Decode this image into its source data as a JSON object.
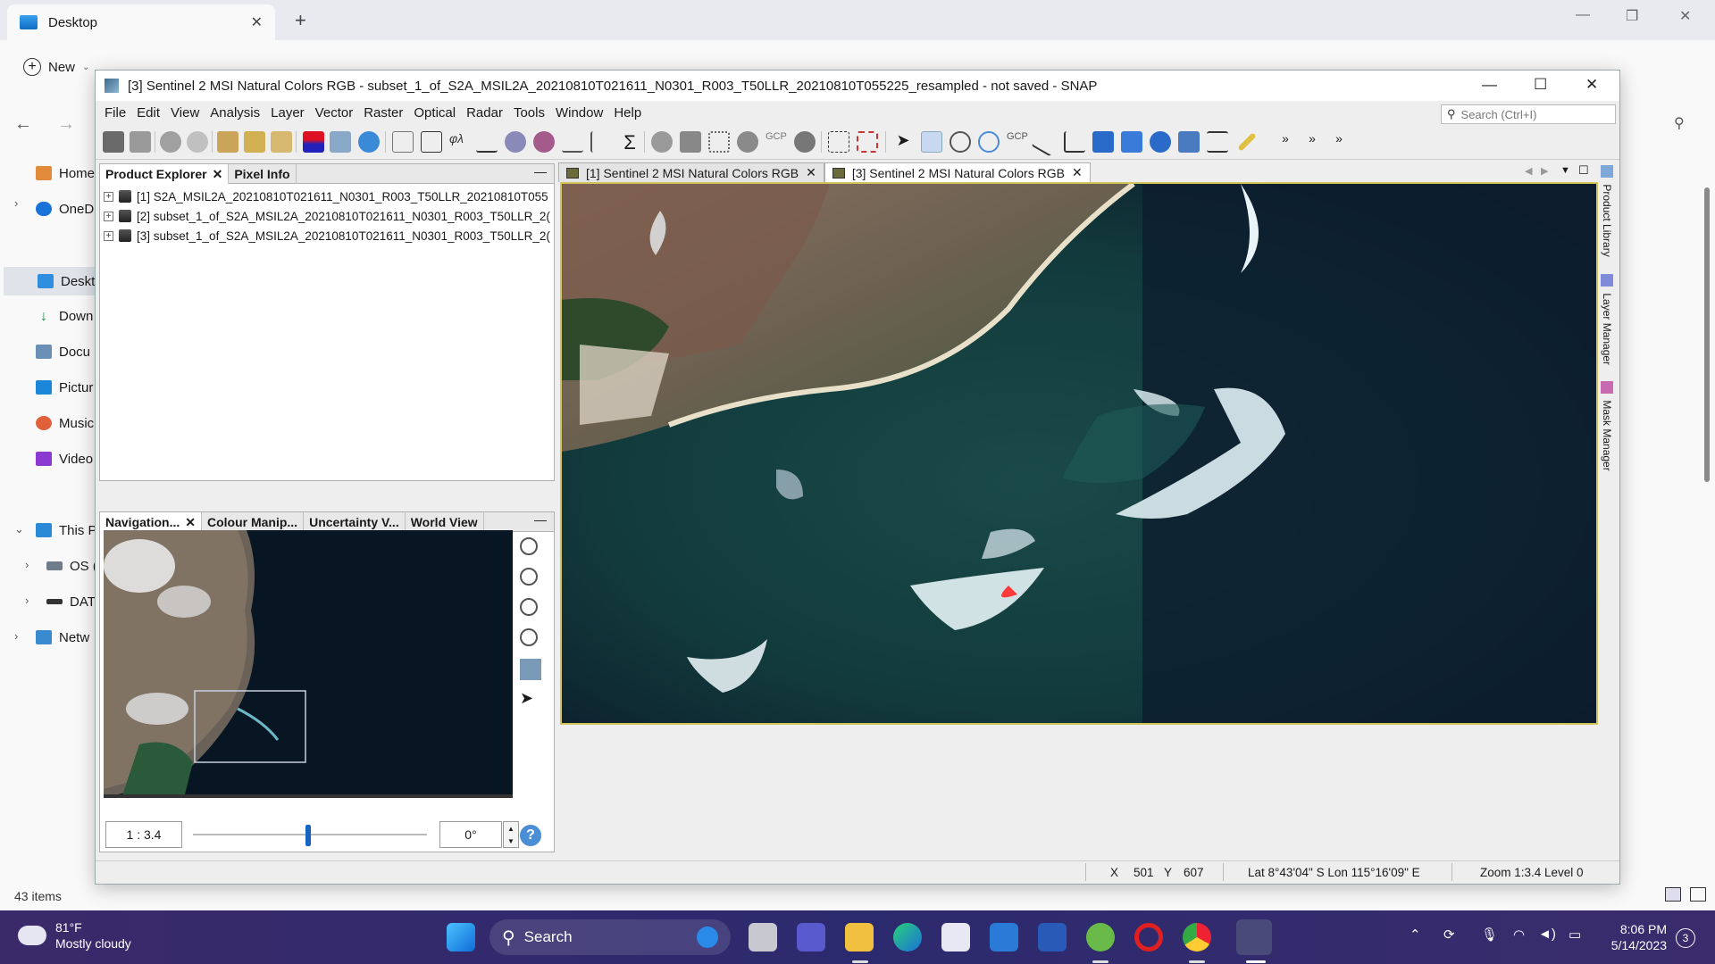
{
  "explorer": {
    "tab_title": "Desktop",
    "new_label": "New",
    "sidebar": [
      {
        "label": "Home",
        "icon": "home-icon"
      },
      {
        "label": "OneD",
        "icon": "onedrive-icon"
      },
      {
        "label": "Deskt",
        "icon": "desktop-icon"
      },
      {
        "label": "Down",
        "icon": "download-icon"
      },
      {
        "label": "Docu",
        "icon": "documents-icon"
      },
      {
        "label": "Pictur",
        "icon": "pictures-icon"
      },
      {
        "label": "Music",
        "icon": "music-icon"
      },
      {
        "label": "Video",
        "icon": "videos-icon"
      },
      {
        "label": "This P",
        "icon": "this-pc-icon"
      },
      {
        "label": "OS (",
        "icon": "drive-icon"
      },
      {
        "label": "DAT",
        "icon": "drive-icon"
      },
      {
        "label": "Netw",
        "icon": "network-icon"
      }
    ],
    "status": "43 items"
  },
  "snap": {
    "title": "[3] Sentinel 2 MSI Natural Colors RGB - subset_1_of_S2A_MSIL2A_20210810T021611_N0301_R003_T50LLR_20210810T055225_resampled - not saved - SNAP",
    "menu": [
      "File",
      "Edit",
      "View",
      "Analysis",
      "Layer",
      "Vector",
      "Raster",
      "Optical",
      "Radar",
      "Tools",
      "Window",
      "Help"
    ],
    "search_placeholder": "Search (Ctrl+I)",
    "product_tabs": [
      "Product Explorer",
      "Pixel Info"
    ],
    "products": [
      "[1] S2A_MSIL2A_20210810T021611_N0301_R003_T50LLR_20210810T055",
      "[2] subset_1_of_S2A_MSIL2A_20210810T021611_N0301_R003_T50LLR_2(",
      "[3] subset_1_of_S2A_MSIL2A_20210810T021611_N0301_R003_T50LLR_2("
    ],
    "tool_tabs": [
      "Navigation...",
      "Colour Manip...",
      "Uncertainty V...",
      "World View"
    ],
    "nav_zoom": "1 : 3.4",
    "nav_angle": "0°",
    "view_tabs": [
      "[1] Sentinel 2 MSI Natural Colors RGB",
      "[3] Sentinel 2 MSI Natural Colors RGB"
    ],
    "right_panels": [
      "Product Library",
      "Layer Manager",
      "Mask Manager"
    ],
    "status": {
      "x_label": "X",
      "x_value": "501",
      "y_label": "Y",
      "y_value": "607",
      "latlon": "Lat 8°43'04\" S  Lon 115°16'09\" E",
      "zoom": "Zoom 1:3.4  Level 0"
    }
  },
  "taskbar": {
    "weather_temp": "81°F",
    "weather_desc": "Mostly cloudy",
    "search_label": "Search",
    "time": "8:06 PM",
    "date": "5/14/2023",
    "notification_count": "3"
  }
}
